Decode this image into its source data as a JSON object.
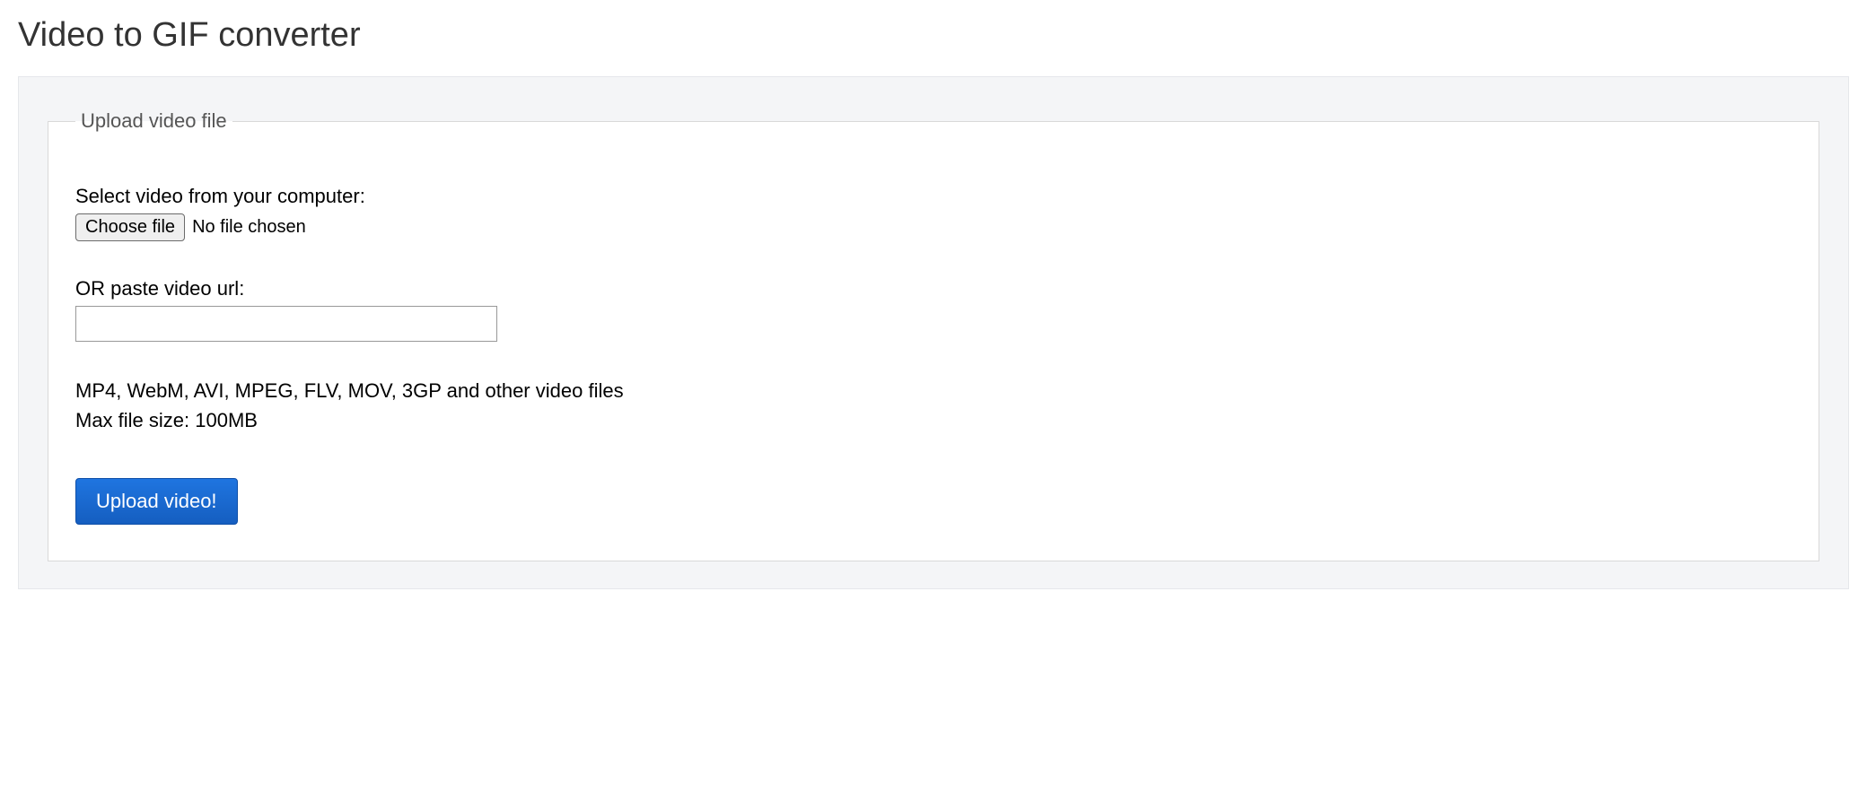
{
  "page": {
    "title": "Video to GIF converter"
  },
  "form": {
    "legend": "Upload video file",
    "select_label": "Select video from your computer:",
    "choose_button": "Choose file",
    "file_status": "No file chosen",
    "url_label": "OR paste video url:",
    "url_value": "",
    "formats_text": "MP4, WebM, AVI, MPEG, FLV, MOV, 3GP and other video files",
    "max_size_text": "Max file size: 100MB",
    "submit_label": "Upload video!"
  }
}
